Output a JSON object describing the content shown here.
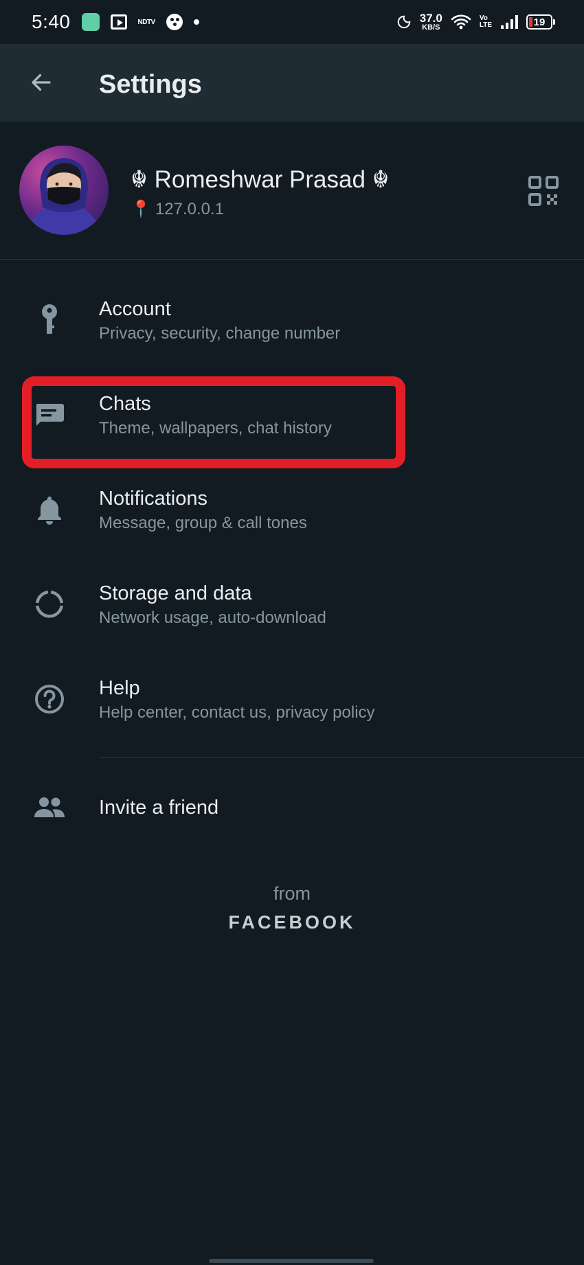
{
  "status_bar": {
    "time": "5:40",
    "ndtv": "NDTV",
    "net_speed": "37.0",
    "net_unit": "KB/S",
    "volte_top": "Vo",
    "volte_bottom": "LTE",
    "battery": "19"
  },
  "app_bar": {
    "title": "Settings"
  },
  "profile": {
    "name": "☬ Romeshwar Prasad ☬",
    "status": "127.0.0.1"
  },
  "menu": [
    {
      "title": "Account",
      "subtitle": "Privacy, security, change number",
      "icon": "key-icon"
    },
    {
      "title": "Chats",
      "subtitle": "Theme, wallpapers, chat history",
      "icon": "chat-icon"
    },
    {
      "title": "Notifications",
      "subtitle": "Message, group & call tones",
      "icon": "bell-icon"
    },
    {
      "title": "Storage and data",
      "subtitle": "Network usage, auto-download",
      "icon": "data-usage-icon"
    },
    {
      "title": "Help",
      "subtitle": "Help center, contact us, privacy policy",
      "icon": "help-icon"
    }
  ],
  "invite": {
    "title": "Invite a friend",
    "icon": "people-icon"
  },
  "footer": {
    "from": "from",
    "brand": "FACEBOOK"
  },
  "colors": {
    "background": "#121b22",
    "app_bar": "#1f2c34",
    "primary_text": "#e9edef",
    "secondary_text": "#8696a0",
    "highlight": "#e41e26"
  }
}
